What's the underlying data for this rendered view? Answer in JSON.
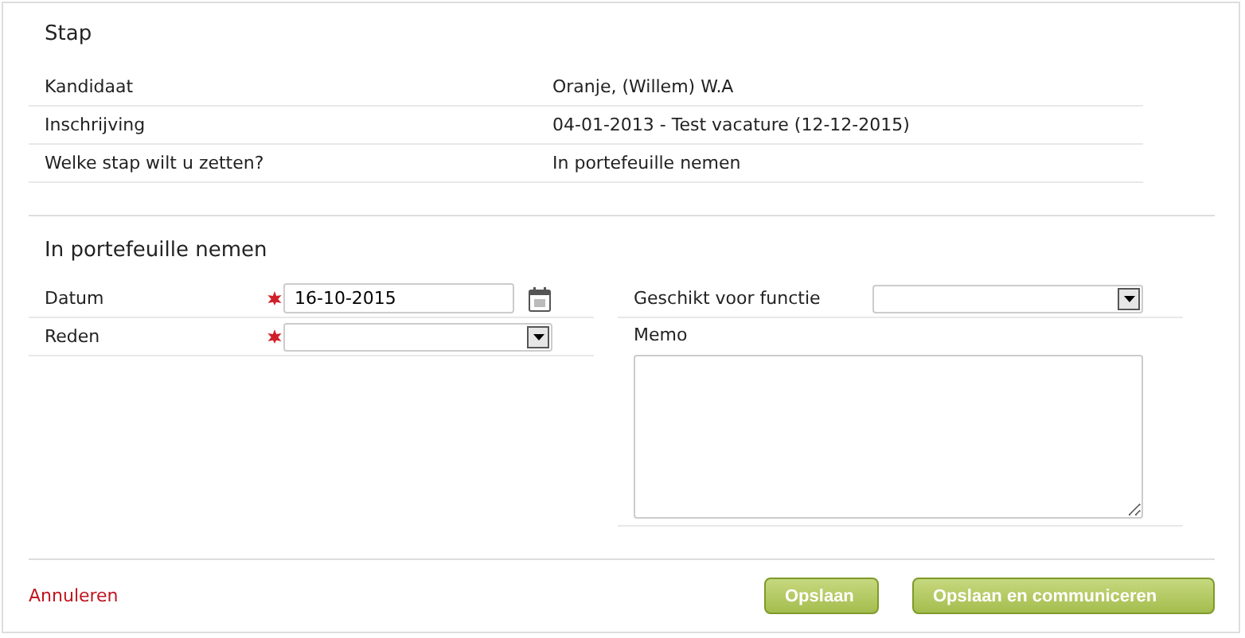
{
  "step_section": {
    "title": "Stap",
    "rows": [
      {
        "label": "Kandidaat",
        "value": "Oranje, (Willem) W.A"
      },
      {
        "label": "Inschrijving",
        "value": "04-01-2013 - Test vacature (12-12-2015)"
      },
      {
        "label": "Welke stap wilt u zetten?",
        "value": "In portefeuille nemen"
      }
    ]
  },
  "form_section": {
    "title": "In portefeuille nemen",
    "left_fields": [
      {
        "kind": "date",
        "label": "Datum",
        "required": true,
        "value": "16-10-2015"
      },
      {
        "kind": "select",
        "label": "Reden",
        "required": true
      }
    ],
    "right_fields": [
      {
        "kind": "select",
        "label": "Geschikt voor functie"
      },
      {
        "kind": "textarea",
        "label": "Memo"
      }
    ]
  },
  "footer": {
    "cancel": "Annuleren",
    "buttons": [
      "Opslaan",
      "Opslaan en communiceren"
    ]
  }
}
